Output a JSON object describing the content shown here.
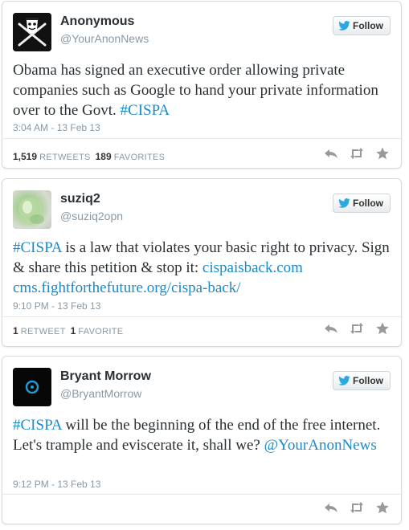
{
  "tweets": [
    {
      "name": "Anonymous",
      "handle": "@YourAnonNews",
      "avatar_icon": "anonymous-jolly-roger-icon",
      "follow_label": "Follow",
      "text_parts": [
        "Obama has signed an executive order allowing private companies such as Google to hand your private information over to the Govt. ",
        "#CISPA"
      ],
      "date": "3:04 AM - 13 Feb 13",
      "retweets_count": "1,519",
      "retweets_label": "RETWEETS",
      "favorites_count": "189",
      "favorites_label": "FAVORITES"
    },
    {
      "name": "suziq2",
      "handle": "@suziq2opn",
      "avatar_icon": "green-blob-avatar",
      "follow_label": "Follow",
      "text_parts": [
        "#CISPA",
        " is a law that violates your basic right to privacy. Sign & share this petition & stop it: ",
        "cispaisback.com",
        "cms.fightforthefuture.org/cispa-back/"
      ],
      "date": "9:10 PM - 13 Feb 13",
      "retweets_count": "1",
      "retweets_label": "RETWEET",
      "favorites_count": "1",
      "favorites_label": "FAVORITE"
    },
    {
      "name": "Bryant Morrow",
      "handle": "@BryantMorrow",
      "avatar_icon": "blue-ring-icon",
      "follow_label": "Follow",
      "text_parts": [
        "#CISPA",
        " will be the beginning of the end of the free internet. Let's trample and eviscerate it, shall we? ",
        "@YourAnonNews"
      ],
      "date": "9:12 PM - 13 Feb 13"
    }
  ],
  "colors": {
    "link": "#1b8ac9",
    "muted": "#8899a6",
    "twitter_bird": "#2aa9e0",
    "action_icon": "#999999"
  }
}
